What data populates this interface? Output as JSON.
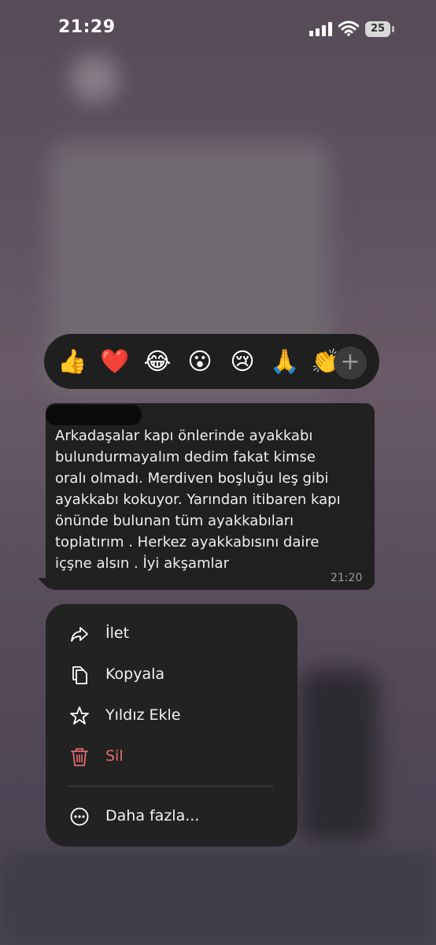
{
  "status_bar": {
    "time": "21:29",
    "battery_percent": "25"
  },
  "reactions": {
    "emojis": [
      "👍",
      "❤️",
      "😂",
      "😮",
      "😢",
      "🙏",
      "👏"
    ],
    "more_icon": "plus-icon"
  },
  "message": {
    "text": "Arkadaşalar kapı önlerinde ayakkabı\nbulundurmayalım dedim fakat kimse\noralı olmadı. Merdiven boşluğu leş gibi\nayakkabı kokuyor. Yarından itibaren kapı\nönünde bulunan tüm ayakkabıları\ntoplatırım . Herkez ayakkabısını daire\niçşne alsın . İyi akşamlar",
    "time": "21:20"
  },
  "context_menu": {
    "items": [
      {
        "label": "İlet",
        "icon": "forward-icon"
      },
      {
        "label": "Kopyala",
        "icon": "copy-icon"
      },
      {
        "label": "Yıldız Ekle",
        "icon": "star-icon"
      },
      {
        "label": "Sil",
        "icon": "trash-icon"
      },
      {
        "label": "Daha fazla...",
        "icon": "more-icon"
      }
    ]
  },
  "colors": {
    "delete": "#e56b6b",
    "bubble": "#202020",
    "menu": "#222222"
  }
}
